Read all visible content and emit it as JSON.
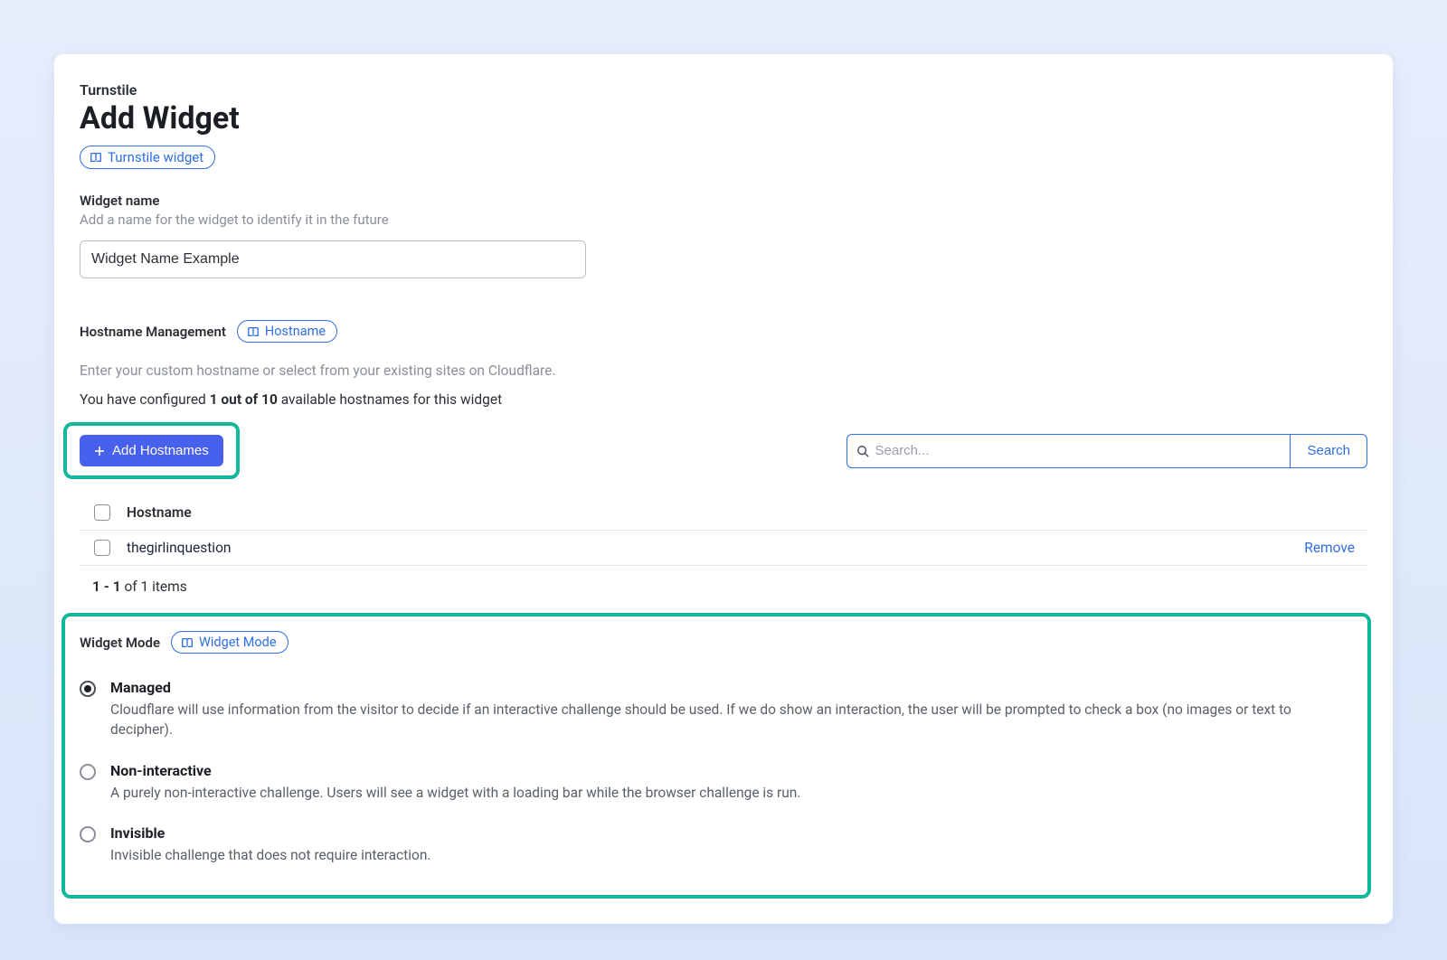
{
  "header": {
    "breadcrumb": "Turnstile",
    "title": "Add Widget",
    "pill_label": "Turnstile widget"
  },
  "widget_name": {
    "label": "Widget name",
    "help": "Add a name for the widget to identify it in the future",
    "value": "Widget Name Example"
  },
  "hostname": {
    "section_label": "Hostname Management",
    "pill_label": "Hostname",
    "description": "Enter your custom hostname or select from your existing sites on Cloudflare.",
    "count_prefix": "You have configured ",
    "count_bold": "1 out of 10",
    "count_suffix": " available hostnames for this widget",
    "add_button": "Add Hostnames",
    "search_placeholder": "Search...",
    "search_button": "Search",
    "column_header": "Hostname",
    "rows": [
      {
        "name": "thegirlinquestion",
        "action": "Remove"
      }
    ],
    "pager_bold": "1 - 1",
    "pager_rest": " of 1 items"
  },
  "mode": {
    "section_label": "Widget Mode",
    "pill_label": "Widget Mode",
    "options": [
      {
        "label": "Managed",
        "desc": "Cloudflare will use information from the visitor to decide if an interactive challenge should be used. If we do show an interaction, the user will be prompted to check a box (no images or text to decipher).",
        "selected": true
      },
      {
        "label": "Non-interactive",
        "desc": "A purely non-interactive challenge. Users will see a widget with a loading bar while the browser challenge is run.",
        "selected": false
      },
      {
        "label": "Invisible",
        "desc": "Invisible challenge that does not require interaction.",
        "selected": false
      }
    ]
  }
}
